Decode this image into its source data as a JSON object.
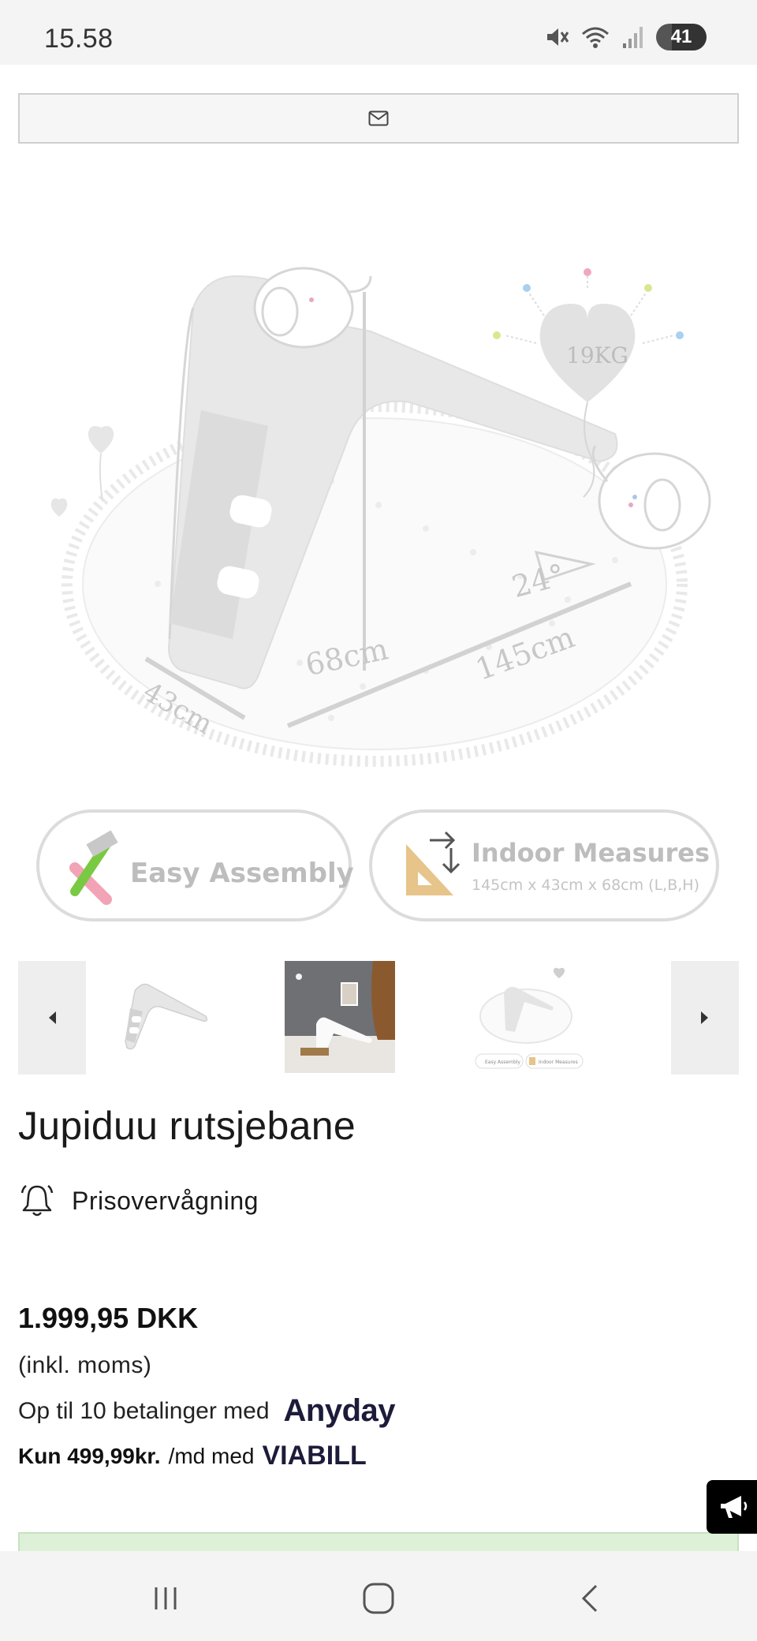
{
  "status_bar": {
    "time": "15.58",
    "battery": "41",
    "icons": [
      "mute-icon",
      "wifi-icon",
      "signal-icon",
      "battery-icon"
    ]
  },
  "newsletter": {
    "icon": "mail-icon"
  },
  "hero": {
    "weight_label": "19KG",
    "dimension_height": "68cm",
    "dimension_length": "145cm",
    "dimension_width": "43cm",
    "angle": "24°",
    "badge_assembly": "Easy Assembly",
    "badge_measures_title": "Indoor Measures",
    "badge_measures_sub": "145cm x 43cm x 68cm (L,B,H)"
  },
  "thumbnails": {
    "prev_icon": "caret-left-icon",
    "next_icon": "caret-right-icon",
    "items": [
      "slide-white",
      "slide-room",
      "slide-diagram"
    ],
    "mini_assembly": "Easy Assembly",
    "mini_measures": "Indoor Measures"
  },
  "product": {
    "title": "Jupiduu rutsjebane",
    "price_watch_label": "Prisovervågning",
    "price": "1.999,95 DKK",
    "vat_note": "(inkl. moms)",
    "anyday_text": "Op til 10 betalinger med",
    "anyday_logo": "Anyday",
    "viabill_prefix": "Kun 499,99kr.",
    "viabill_text": "/md med",
    "viabill_logo": "VIABILL"
  },
  "colors": {
    "accent_green_bar": "#dff0d8",
    "button_black": "#000000",
    "text_dark": "#1a1a1a"
  },
  "nav": {
    "icons": [
      "recents-icon",
      "home-icon",
      "back-icon"
    ]
  }
}
